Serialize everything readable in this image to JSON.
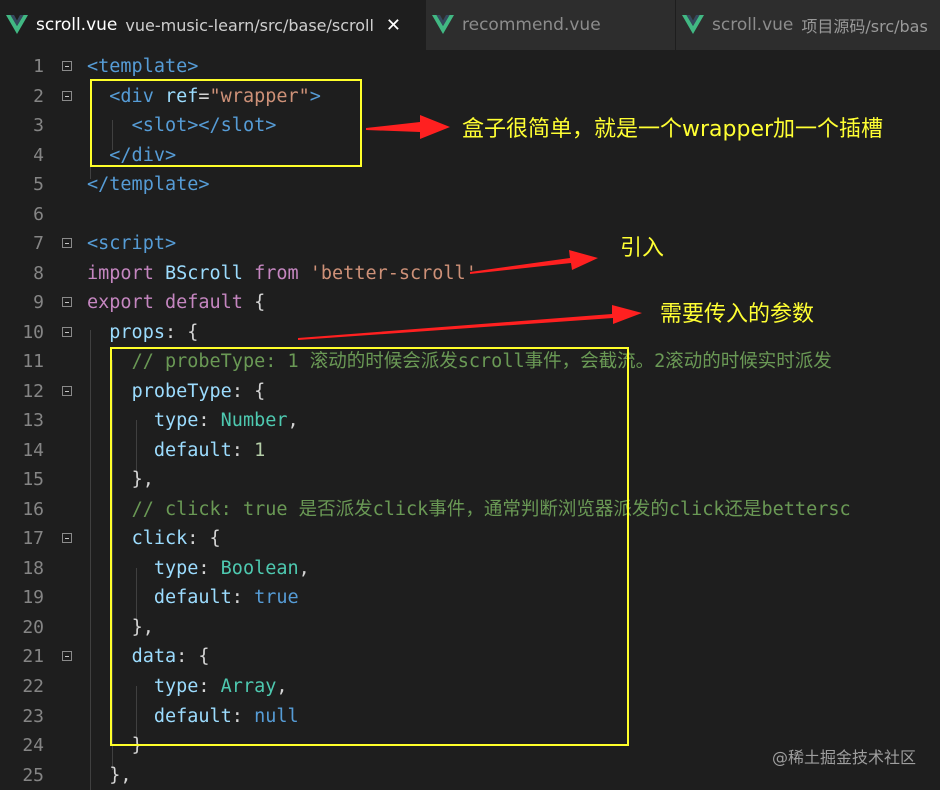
{
  "tabs": [
    {
      "filename": "scroll.vue",
      "path": "vue-music-learn/src/base/scroll",
      "close": "✕",
      "active": true
    },
    {
      "filename": "recommend.vue",
      "path": "",
      "active": false
    },
    {
      "filename": "scroll.vue",
      "path": "项目源码/src/bas",
      "active": false
    }
  ],
  "line_numbers": [
    "1",
    "2",
    "3",
    "4",
    "5",
    "6",
    "7",
    "8",
    "9",
    "10",
    "11",
    "12",
    "13",
    "14",
    "15",
    "16",
    "17",
    "18",
    "19",
    "20",
    "21",
    "22",
    "23",
    "24",
    "25"
  ],
  "code": {
    "l1": [
      "<template>"
    ],
    "l2": [
      "<div ",
      "ref",
      "=",
      "\"wrapper\"",
      ">"
    ],
    "l3": [
      "<slot></slot>"
    ],
    "l4": [
      "</div>"
    ],
    "l5": [
      "</template>"
    ],
    "l7": [
      "<script>"
    ],
    "l8": [
      "import ",
      "BScroll",
      " from ",
      "'better-scroll'"
    ],
    "l9": [
      "export ",
      "default",
      " {"
    ],
    "l10": [
      "props",
      ": {"
    ],
    "l11": [
      "// probeType: 1 滚动的时候会派发scroll事件，会截流。2滚动的时候实时派发"
    ],
    "l12": [
      "probeType",
      ": {"
    ],
    "l13": [
      "type",
      ": ",
      "Number",
      ","
    ],
    "l14": [
      "default",
      ": ",
      "1"
    ],
    "l15": [
      "},"
    ],
    "l16": [
      "// click: true 是否派发click事件，通常判断浏览器派发的click还是bettersc"
    ],
    "l17": [
      "click",
      ": {"
    ],
    "l18": [
      "type",
      ": ",
      "Boolean",
      ","
    ],
    "l19": [
      "default",
      ": ",
      "true"
    ],
    "l20": [
      "},"
    ],
    "l21": [
      "data",
      ": {"
    ],
    "l22": [
      "type",
      ": ",
      "Array",
      ","
    ],
    "l23": [
      "default",
      ": ",
      "null"
    ],
    "l24": [
      "}"
    ],
    "l25": [
      "},"
    ]
  },
  "annotations": {
    "note1": "盒子很简单，就是一个wrapper加一个插槽",
    "note2": "引入",
    "note3": "需要传入的参数"
  },
  "watermark": "@稀土掘金技术社区",
  "colors": {
    "highlight": "#ffff2a",
    "arrow": "#ff2020",
    "vue_green": "#41b883"
  }
}
